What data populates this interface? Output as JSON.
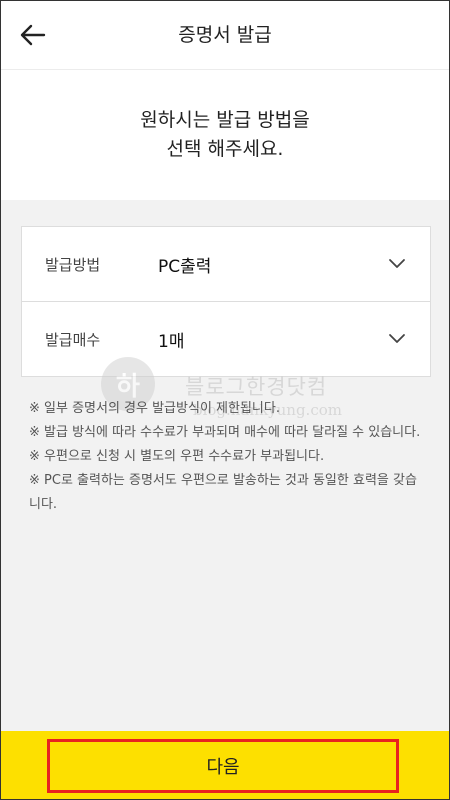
{
  "header": {
    "title": "증명서 발급",
    "back_icon": "arrow-left-icon"
  },
  "prompt": {
    "line1": "원하시는 발급 방법을",
    "line2": "선택 해주세요."
  },
  "form": {
    "rows": [
      {
        "label": "발급방법",
        "value": "PC출력",
        "icon": "chevron-down-icon"
      },
      {
        "label": "발급매수",
        "value": "1매",
        "icon": "chevron-down-icon"
      }
    ]
  },
  "notes": [
    "※ 일부 증명서의 경우 발급방식이 제한됩니다.",
    "※ 발급 방식에 따라 수수료가 부과되며 매수에 따라 달라질 수 있습니다.",
    "※ 우편으로 신청 시 별도의 우편 수수료가 부과됩니다.",
    "※ PC로 출력하는 증명서도 우편으로 발송하는 것과 동일한 효력을 갖습니다."
  ],
  "watermark": {
    "mark": "하",
    "text": "블로그한경닷컴",
    "url": "blog.hankyung.com"
  },
  "footer": {
    "next_label": "다음"
  },
  "colors": {
    "accent_yellow": "#fde000",
    "highlight_red": "#e8231f"
  }
}
